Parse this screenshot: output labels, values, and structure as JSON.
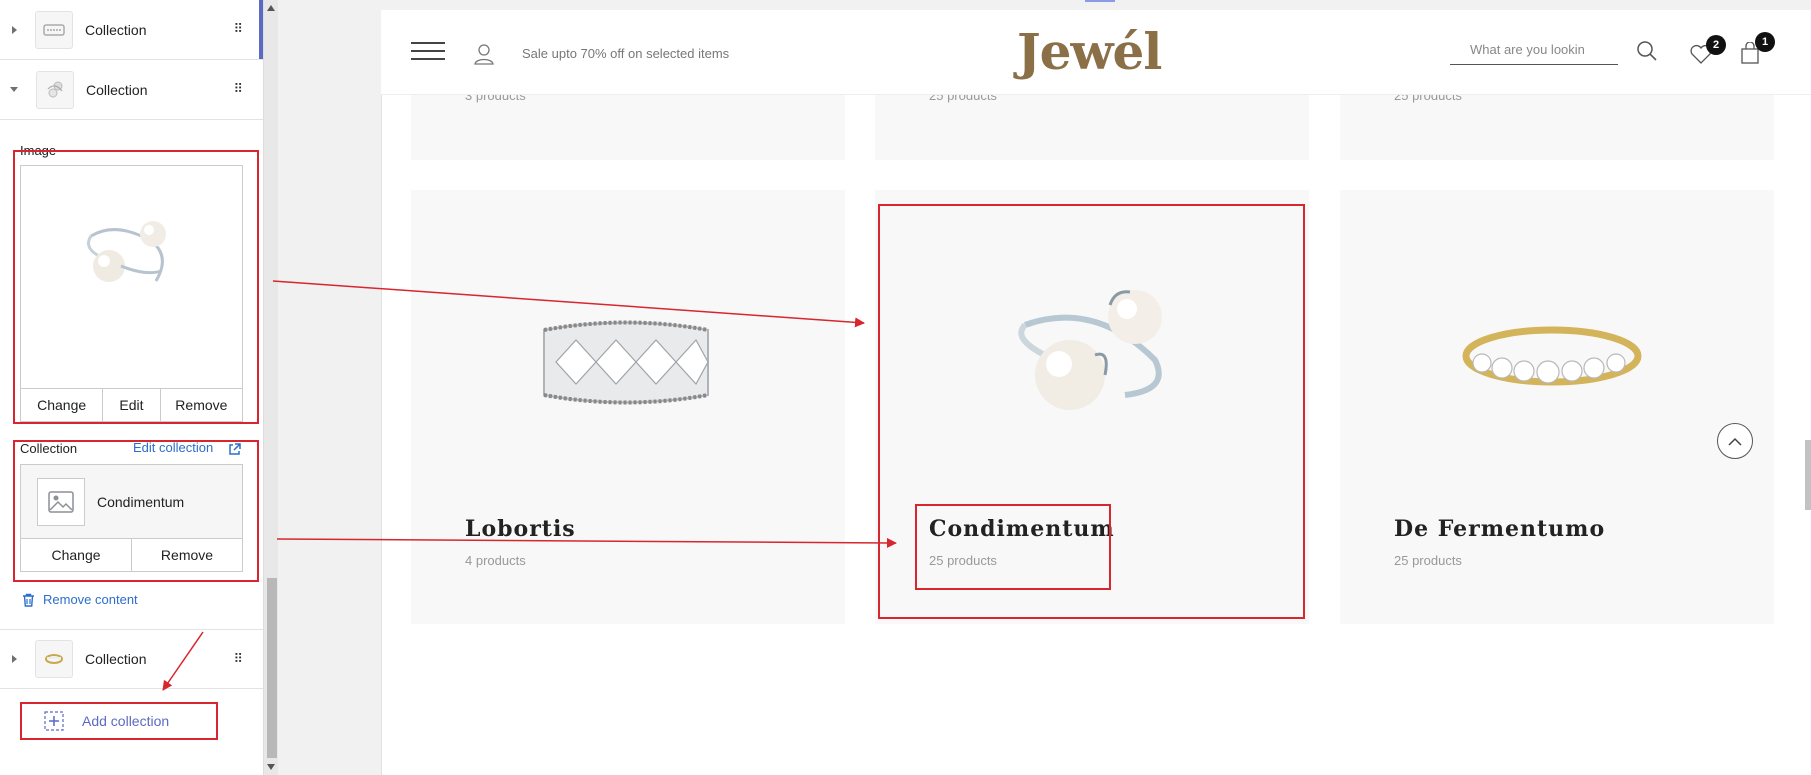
{
  "sidebar": {
    "collections": [
      {
        "label": "Collection"
      },
      {
        "label": "Collection"
      },
      {
        "label": "Collection"
      }
    ],
    "image_field": {
      "label": "Image",
      "buttons": [
        "Change",
        "Edit",
        "Remove"
      ]
    },
    "collection_field": {
      "label": "Collection",
      "edit_link": "Edit collection",
      "selected": "Condimentum",
      "buttons": [
        "Change",
        "Remove"
      ]
    },
    "remove_content": "Remove content",
    "add_collection": "Add collection"
  },
  "store": {
    "promo": "Sale upto 70% off on selected items",
    "logo": "Jewél",
    "search_placeholder": "What are you lookin",
    "wishlist_count": "2",
    "cart_count": "1",
    "top_row_counts": [
      "3 products",
      "25 products",
      "25 products"
    ],
    "cards": [
      {
        "title": "Lobortis",
        "count": "4 products"
      },
      {
        "title": "Condimentum",
        "count": "25 products"
      },
      {
        "title": "De Fermentumo",
        "count": "25 products"
      }
    ]
  },
  "colors": {
    "annotation_red": "#d7262e",
    "logo_brown": "#8b6f47",
    "link_blue": "#2c6ecb"
  }
}
